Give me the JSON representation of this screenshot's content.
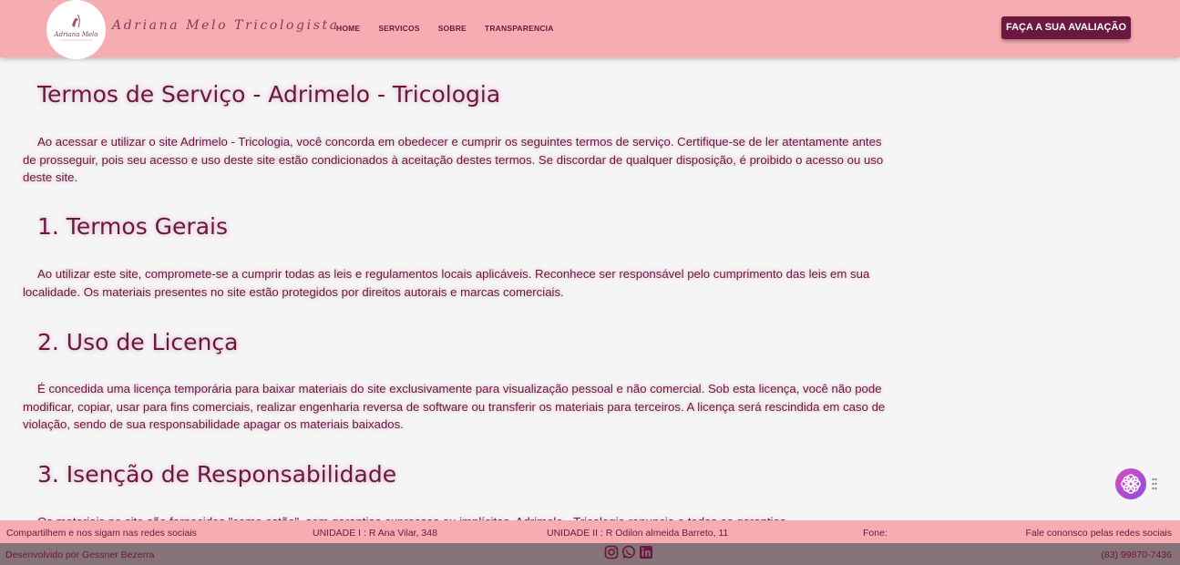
{
  "header": {
    "brand": "Adriana Melo Tricologista",
    "nav": [
      "HOME",
      "SERVICOS",
      "SOBRE",
      "TRANSPARENCIA"
    ],
    "cta": "FAÇA A SUA AVALIAÇÃO",
    "logo_text": "Adriana Melo"
  },
  "page": {
    "title": "Termos de Serviço - Adrimelo - Tricologia",
    "intro": "Ao acessar e utilizar o site Adrimelo - Tricologia, você concorda em obedecer e cumprir os seguintes termos de serviço. Certifique-se de ler atentamente antes de prosseguir, pois seu acesso e uso deste site estão condicionados à aceitação destes termos. Se discordar de qualquer disposição, é proibido o acesso ou uso deste site.",
    "sections": [
      {
        "heading": "1. Termos Gerais",
        "text": "Ao utilizar este site, compromete-se a cumprir todas as leis e regulamentos locais aplicáveis. Reconhece ser responsável pelo cumprimento das leis em sua localidade. Os materiais presentes no site estão protegidos por direitos autorais e marcas comerciais."
      },
      {
        "heading": "2. Uso de Licença",
        "text": "É concedida uma licença temporária para baixar materiais do site exclusivamente para visualização pessoal e não comercial. Sob esta licença, você não pode modificar, copiar, usar para fins comerciais, realizar engenharia reversa de software ou transferir os materiais para terceiros. A licença será rescindida em caso de violação, sendo de sua responsabilidade apagar os materiais baixados."
      },
      {
        "heading": "3. Isenção de Responsabilidade",
        "text": "Os materiais no site são fornecidos \"como estão\", sem garantias expressas ou implícitas. Adrimelo - Tricologia renuncia a todas as garantias"
      }
    ]
  },
  "footer": {
    "social_text": "Compartilhem e nos sigam nas redes sociais",
    "unit1": "UNIDADE I : R Ana Vilar, 348",
    "unit2": "UNIDADE II : R Odilon almeida Barreto, 11",
    "phone_label": "Fone:",
    "contact_text": "Fale cononsco pelas redes sociais",
    "developer": "Desenvolvido por Gessner Bezerra",
    "phone": "(83) 99870-7436",
    "social_icons": [
      "instagram-icon",
      "whatsapp-icon",
      "linkedin-icon"
    ]
  },
  "colors": {
    "header_bg": "#f6adb1",
    "accent": "#6b1740",
    "footer_bottom_bg": "#857377",
    "page_bg": "#f6f5f6"
  }
}
